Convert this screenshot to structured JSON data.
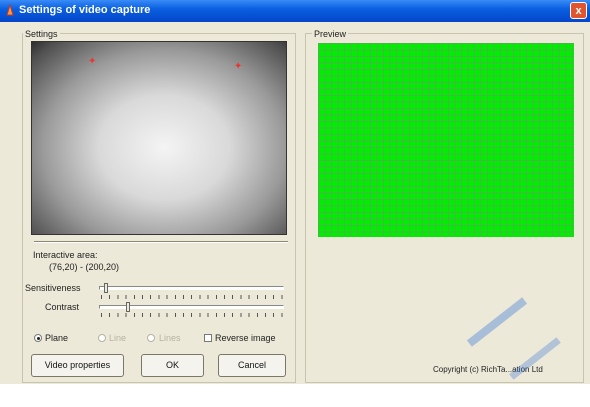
{
  "window": {
    "title": "Settings of video capture",
    "close_label": "x"
  },
  "settings_group": {
    "label": "Settings"
  },
  "preview_group": {
    "label": "Preview"
  },
  "interactive_area": {
    "label": "Interactive area:",
    "value": "(76,20) - (200,20)"
  },
  "sliders": {
    "sensitiveness": {
      "label": "Sensitiveness"
    },
    "contrast": {
      "label": "Contrast"
    }
  },
  "mode": {
    "options": [
      {
        "label": "Plane",
        "selected": true,
        "enabled": true
      },
      {
        "label": "Line",
        "selected": false,
        "enabled": false
      },
      {
        "label": "Lines",
        "selected": false,
        "enabled": false
      }
    ]
  },
  "reverse_image": {
    "label": "Reverse image",
    "checked": false
  },
  "buttons": {
    "video_properties": "Video properties",
    "ok": "OK",
    "cancel": "Cancel"
  },
  "copyright": "Copyright (c) RichTa...ation Ltd",
  "colors": {
    "titlebar": "#0a5fe0",
    "preview": "#00ee00",
    "dialog": "#ece9d8"
  }
}
